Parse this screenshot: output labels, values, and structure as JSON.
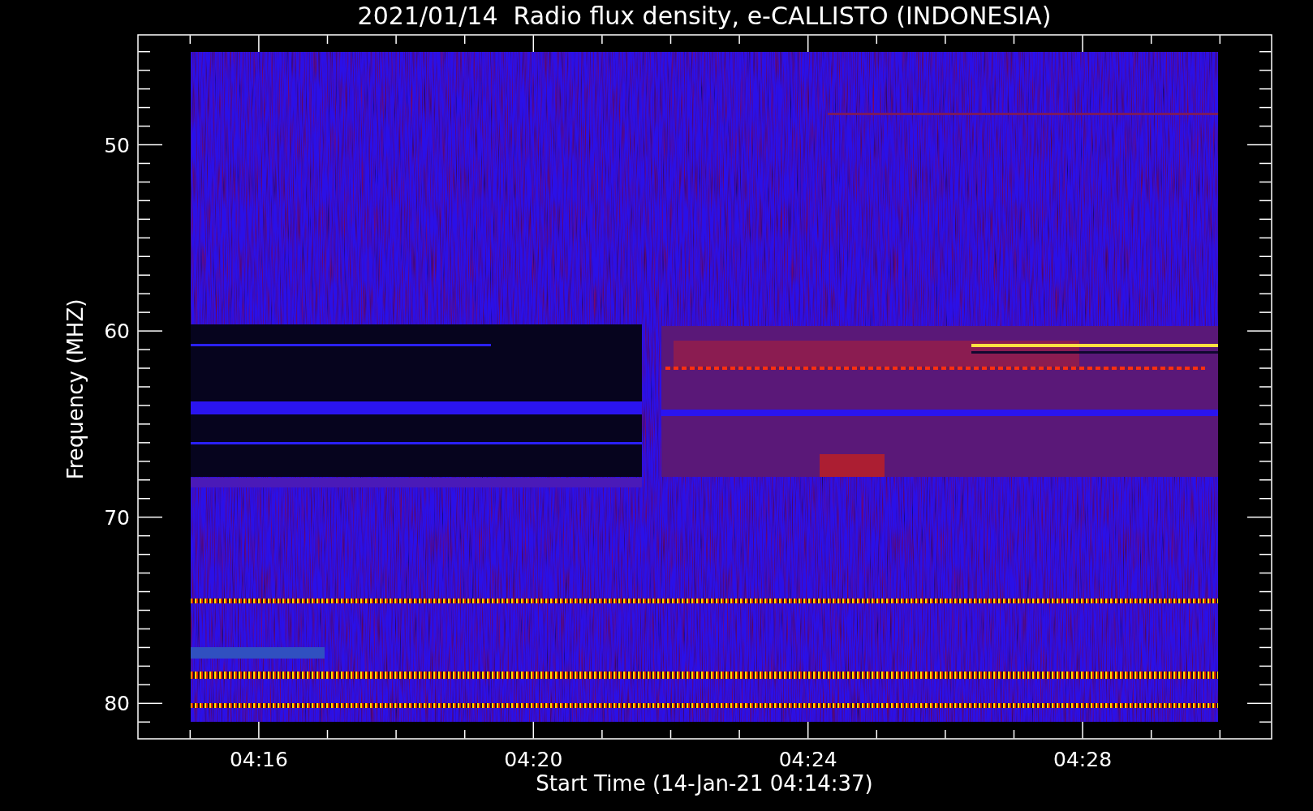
{
  "title": "2021/01/14  Radio flux density, e-CALLISTO (INDONESIA)",
  "xlabel": "Start Time (14-Jan-21 04:14:37)",
  "ylabel": "Frequency (MHZ)",
  "xtick_labels": [
    "04:16",
    "04:20",
    "04:24",
    "04:28"
  ],
  "ytick_labels": [
    "50",
    "60",
    "70",
    "80"
  ]
}
